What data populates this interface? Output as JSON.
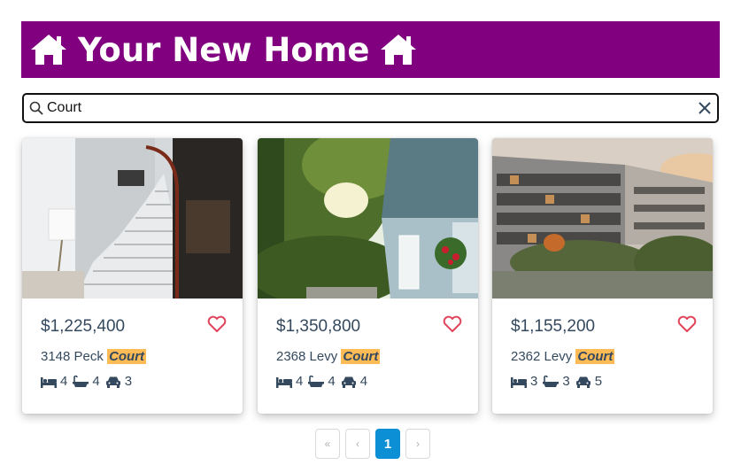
{
  "header": {
    "title": "Your New Home",
    "icon_left": "house-icon",
    "icon_right": "house-icon",
    "bg_color": "#800080"
  },
  "search": {
    "value": "Court",
    "placeholder": ""
  },
  "listings": [
    {
      "price": "$1,225,400",
      "address_prefix": "3148 Peck ",
      "address_match": "Court",
      "beds": "4",
      "baths": "4",
      "cars": "3",
      "photo": "staircase-interior"
    },
    {
      "price": "$1,350,800",
      "address_prefix": "2368 Levy ",
      "address_match": "Court",
      "beds": "4",
      "baths": "4",
      "cars": "4",
      "photo": "house-garden"
    },
    {
      "price": "$1,155,200",
      "address_prefix": "2362 Levy ",
      "address_match": "Court",
      "beds": "3",
      "baths": "3",
      "cars": "5",
      "photo": "apartment-building"
    }
  ],
  "pagination": {
    "first": "«",
    "prev": "‹",
    "current": "1",
    "next": "›"
  },
  "colors": {
    "accent": "#0d8fd6",
    "highlight": "#ffbb55",
    "heart": "#e0445a",
    "text": "#34495e"
  }
}
